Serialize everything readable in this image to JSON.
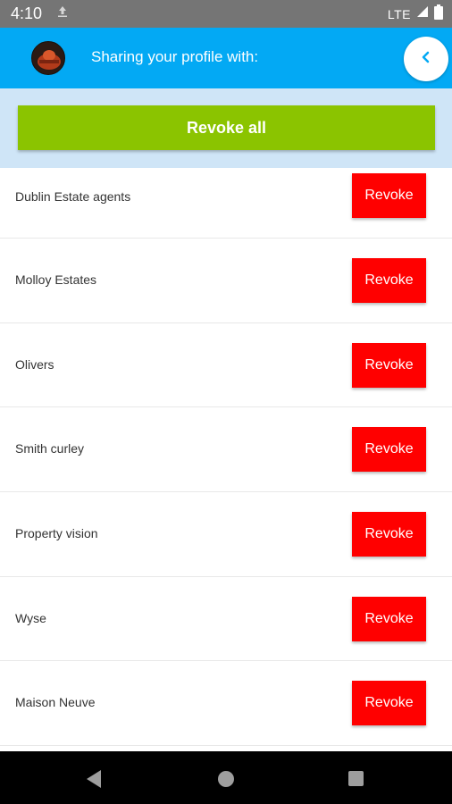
{
  "status_bar": {
    "time": "4:10",
    "network": "LTE",
    "icons": [
      "upload-icon",
      "signal-icon",
      "battery-icon"
    ]
  },
  "header": {
    "title": "Sharing your profile with:",
    "avatar": "avatar",
    "back_icon": "chevron-left-icon"
  },
  "revoke_all": {
    "label": "Revoke all"
  },
  "items": [
    {
      "name": "Dublin Estate agents",
      "action": "Revoke"
    },
    {
      "name": "Molloy Estates",
      "action": "Revoke"
    },
    {
      "name": "Olivers",
      "action": "Revoke"
    },
    {
      "name": "Smith curley",
      "action": "Revoke"
    },
    {
      "name": "Property vision",
      "action": "Revoke"
    },
    {
      "name": "Wyse",
      "action": "Revoke"
    },
    {
      "name": "Maison Neuve",
      "action": "Revoke"
    }
  ],
  "nav_bar": {
    "icons": [
      "nav-back-icon",
      "nav-home-icon",
      "nav-recents-icon"
    ]
  },
  "colors": {
    "header": "#03a9f4",
    "revoke_all": "#8bc400",
    "revoke": "#ff0000",
    "panel": "#cfe5f7"
  }
}
